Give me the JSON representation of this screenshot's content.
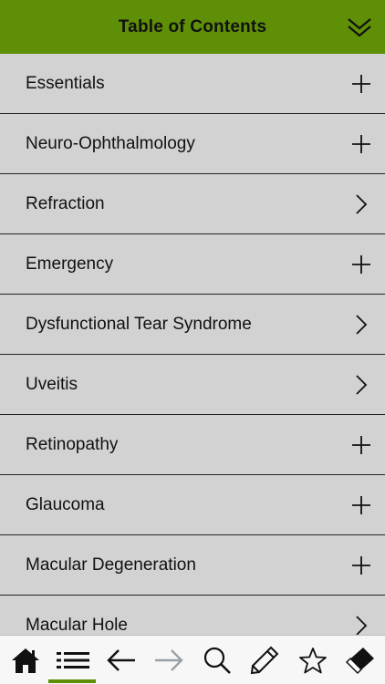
{
  "header": {
    "title": "Table of Contents",
    "collapse_icon": "double-chevron-down-icon",
    "background_color": "#5f8f06"
  },
  "toc": {
    "items": [
      {
        "label": "Essentials",
        "icon": "plus-icon"
      },
      {
        "label": "Neuro-Ophthalmology",
        "icon": "plus-icon"
      },
      {
        "label": "Refraction",
        "icon": "chevron-right-icon"
      },
      {
        "label": "Emergency",
        "icon": "plus-icon"
      },
      {
        "label": "Dysfunctional Tear Syndrome",
        "icon": "chevron-right-icon"
      },
      {
        "label": "Uveitis",
        "icon": "chevron-right-icon"
      },
      {
        "label": "Retinopathy",
        "icon": "plus-icon"
      },
      {
        "label": "Glaucoma",
        "icon": "plus-icon"
      },
      {
        "label": "Macular Degeneration",
        "icon": "plus-icon"
      },
      {
        "label": "Macular Hole",
        "icon": "chevron-right-icon"
      }
    ]
  },
  "toolbar": {
    "active": "list-icon",
    "accent_color": "#5f8f06",
    "buttons": [
      {
        "icon": "home-icon"
      },
      {
        "icon": "list-icon"
      },
      {
        "icon": "back-arrow-icon"
      },
      {
        "icon": "forward-arrow-icon"
      },
      {
        "icon": "search-icon"
      },
      {
        "icon": "pencil-icon"
      },
      {
        "icon": "star-icon"
      },
      {
        "icon": "eraser-icon"
      }
    ]
  }
}
